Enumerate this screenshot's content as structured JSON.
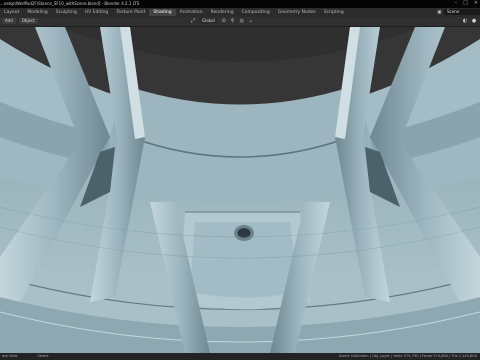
{
  "window": {
    "title": "...nelsp\\WedPod2F\\Stance_SF10_withScene.blend] - Blender 4.2.1 LTS"
  },
  "menubar": {
    "tabs": [
      {
        "label": "Layout",
        "active": false
      },
      {
        "label": "Modeling",
        "active": false
      },
      {
        "label": "Sculpting",
        "active": false
      },
      {
        "label": "UV Editing",
        "active": false
      },
      {
        "label": "Texture Paint",
        "active": false
      },
      {
        "label": "Shading",
        "active": true
      },
      {
        "label": "Animation",
        "active": false
      },
      {
        "label": "Rendering",
        "active": false
      },
      {
        "label": "Compositing",
        "active": false
      },
      {
        "label": "Geometry Nodes",
        "active": false
      },
      {
        "label": "Scripting",
        "active": false
      }
    ],
    "scene_label": "Scene"
  },
  "toolbar": {
    "add_label": "Add",
    "object_label": "Object",
    "transform_orientation": "Global"
  },
  "statusbar": {
    "left_hint": "ate View",
    "middle_hint": "Select",
    "right_info": "Scene Collection | Obj_Layer | Verts 575,750 | Faces 574,800 | Tris 1,140,800"
  },
  "colors": {
    "viewport_bg": "#3b3b3b",
    "mesh_light": "#b7cdd5",
    "mesh_mid": "#93aeb8",
    "mesh_dark": "#5d7780",
    "menubar_bg": "#2b2b2b"
  }
}
